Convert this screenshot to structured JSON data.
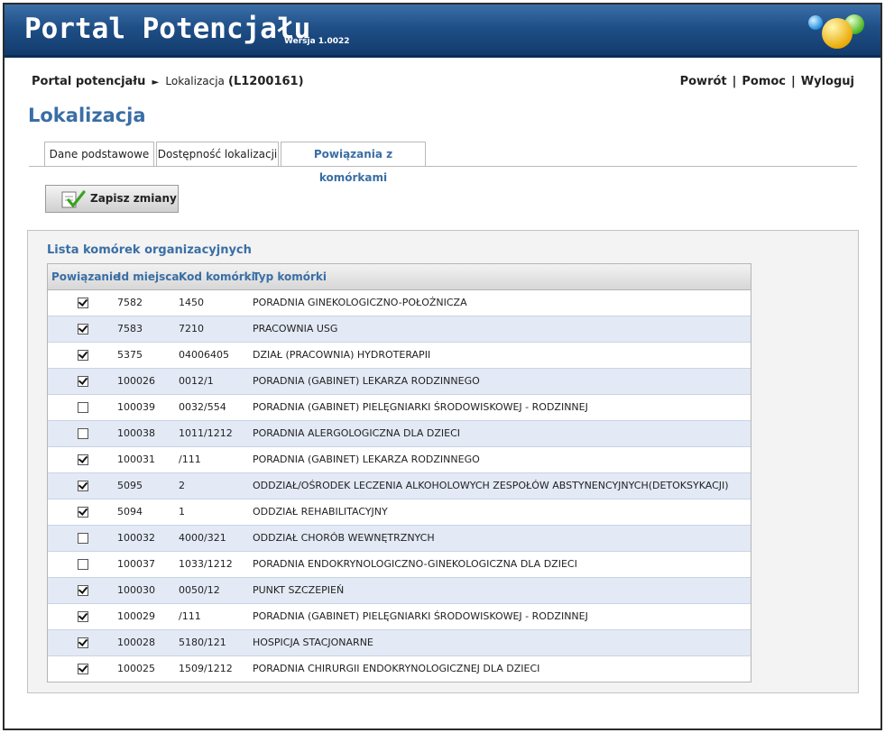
{
  "app": {
    "title": "Portal Potencjału",
    "version": "Wersja 1.0022"
  },
  "breadcrumb": {
    "root": "Portal potencjału",
    "separator": "►",
    "current": "Lokalizacja",
    "id": "(L1200161)"
  },
  "toplinks": {
    "back": "Powrót",
    "help": "Pomoc",
    "logout": "Wyloguj",
    "separator": "|"
  },
  "page": {
    "title": "Lokalizacja"
  },
  "tabs": [
    {
      "label": "Dane podstawowe",
      "active": false
    },
    {
      "label": "Dostępność lokalizacji",
      "active": false
    },
    {
      "label": "Powiązania z komórkami",
      "active": true
    }
  ],
  "toolbar": {
    "save_label": "Zapisz zmiany",
    "save_icon": "check-document-icon"
  },
  "list": {
    "title": "Lista komórek organizacyjnych",
    "columns": [
      "Powiązanie",
      "Id miejsca",
      "Kod komórki",
      "Typ komórki"
    ],
    "rows": [
      {
        "checked": true,
        "id": "7582",
        "code": "1450",
        "type": "PORADNIA GINEKOLOGICZNO-POŁOŻNICZA"
      },
      {
        "checked": true,
        "id": "7583",
        "code": "7210",
        "type": "PRACOWNIA USG"
      },
      {
        "checked": true,
        "id": "5375",
        "code": "04006405",
        "type": "DZIAŁ (PRACOWNIA) HYDROTERAPII"
      },
      {
        "checked": true,
        "id": "100026",
        "code": "0012/1",
        "type": "PORADNIA (GABINET) LEKARZA RODZINNEGO"
      },
      {
        "checked": false,
        "id": "100039",
        "code": "0032/554",
        "type": "PORADNIA (GABINET) PIELĘGNIARKI ŚRODOWISKOWEJ - RODZINNEJ"
      },
      {
        "checked": false,
        "id": "100038",
        "code": "1011/1212",
        "type": "PORADNIA ALERGOLOGICZNA DLA DZIECI"
      },
      {
        "checked": true,
        "id": "100031",
        "code": "/111",
        "type": "PORADNIA (GABINET) LEKARZA RODZINNEGO"
      },
      {
        "checked": true,
        "id": "5095",
        "code": "2",
        "type": "ODDZIAŁ/OŚRODEK LECZENIA ALKOHOLOWYCH ZESPOŁÓW ABSTYNENCYJNYCH(DETOKSYKACJI)"
      },
      {
        "checked": true,
        "id": "5094",
        "code": "1",
        "type": "ODDZIAŁ REHABILITACYJNY"
      },
      {
        "checked": false,
        "id": "100032",
        "code": "4000/321",
        "type": "ODDZIAŁ CHORÓB WEWNĘTRZNYCH"
      },
      {
        "checked": false,
        "id": "100037",
        "code": "1033/1212",
        "type": "PORADNIA ENDOKRYNOLOGICZNO-GINEKOLOGICZNA DLA DZIECI"
      },
      {
        "checked": true,
        "id": "100030",
        "code": "0050/12",
        "type": "PUNKT SZCZEPIEŃ"
      },
      {
        "checked": true,
        "id": "100029",
        "code": "/111",
        "type": "PORADNIA (GABINET) PIELĘGNIARKI ŚRODOWISKOWEJ - RODZINNEJ"
      },
      {
        "checked": true,
        "id": "100028",
        "code": "5180/121",
        "type": "HOSPICJA STACJONARNE"
      },
      {
        "checked": true,
        "id": "100025",
        "code": "1509/1212",
        "type": "PORADNIA CHIRURGII ENDOKRYNOLOGICZNEJ DLA DZIECI"
      }
    ]
  },
  "colors": {
    "banner": "#1f4f87",
    "accent": "#3a6ea5",
    "row_alt": "#e3e9f5"
  }
}
